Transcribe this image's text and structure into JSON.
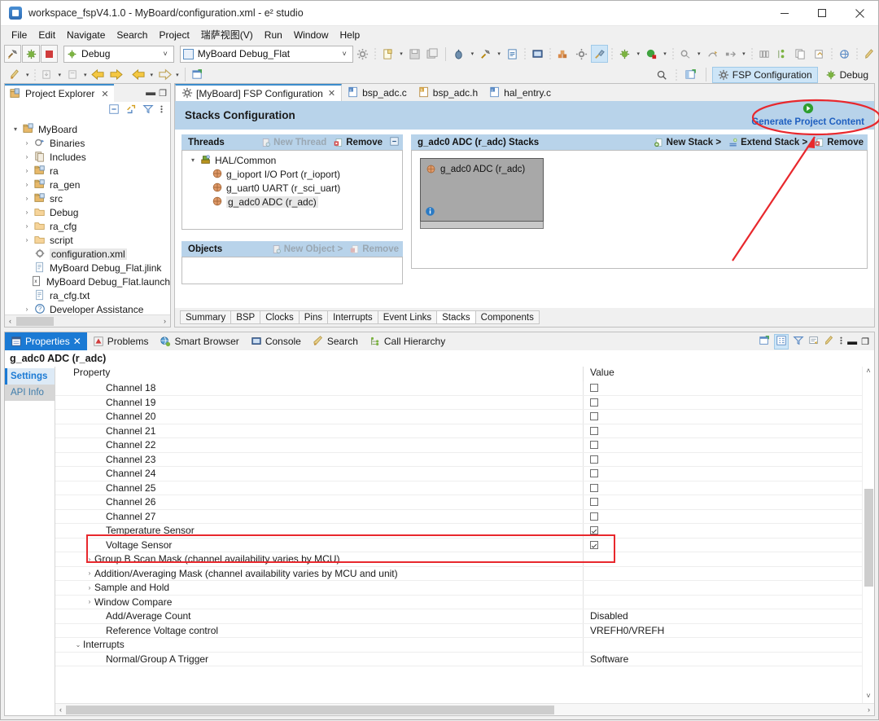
{
  "window": {
    "title": "workspace_fspV4.1.0 - MyBoard/configuration.xml - e² studio",
    "minimize": "—",
    "maximize": "□",
    "close": "✕",
    "app_icon": "e2-studio-icon"
  },
  "menu": [
    "File",
    "Edit",
    "Navigate",
    "Search",
    "Project",
    "瑞萨视图(V)",
    "Run",
    "Window",
    "Help"
  ],
  "toolbar": {
    "build_icon": "hammer-icon",
    "debug_icon": "debug-bug-icon",
    "stop_icon": "stop-icon",
    "launch_mode": "Debug",
    "launch_config": "MyBoard Debug_Flat",
    "icons": [
      "new-file-icon",
      "save-icon",
      "save-all-icon",
      "debug-icon",
      "build-hammer-icon",
      "report-icon",
      "terminal-icon",
      "blocks-icon",
      "gear-icon",
      "pin-tools-icon",
      "run-bug-icon",
      "run-green-icon",
      "skip-icon",
      "step-icon",
      "step-over-icon",
      "columns-icon",
      "outline-icon",
      "copy-icon",
      "export-icon",
      "globe-icon",
      "pencil-icon"
    ],
    "row2_icons": [
      "pencil-edit-icon",
      "download-icon",
      "sync-icon",
      "back-yellow-icon",
      "forward-yellow-icon",
      "back-arrow-icon",
      "forward-arrow-icon",
      "new-window-icon"
    ]
  },
  "perspectives": {
    "search_icon": "search-icon",
    "open_perspective_icon": "open-perspective-icon",
    "items": [
      {
        "label": "FSP Configuration",
        "icon": "gear-icon",
        "active": true
      },
      {
        "label": "Debug",
        "icon": "debug-bug-icon",
        "active": false
      }
    ]
  },
  "project_explorer": {
    "tab_label": "Project Explorer",
    "tab_icon": "project-explorer-icon",
    "close_icon": "✕",
    "minimize_icon": "—",
    "maximize_icon": "□",
    "toolbar_icons": [
      "collapse-all-icon",
      "link-editor-icon",
      "filter-icon",
      "view-menu-icon"
    ],
    "tree": [
      {
        "label": "MyBoard",
        "depth": 0,
        "arrow": "▾",
        "icon": "project-folder-icon",
        "selected": false
      },
      {
        "label": "Binaries",
        "depth": 1,
        "arrow": "›",
        "icon": "binaries-icon",
        "selected": false
      },
      {
        "label": "Includes",
        "depth": 1,
        "arrow": "›",
        "icon": "includes-icon",
        "selected": false
      },
      {
        "label": "ra",
        "depth": 1,
        "arrow": "›",
        "icon": "source-folder-icon",
        "selected": false
      },
      {
        "label": "ra_gen",
        "depth": 1,
        "arrow": "›",
        "icon": "source-folder-icon",
        "selected": false
      },
      {
        "label": "src",
        "depth": 1,
        "arrow": "›",
        "icon": "source-folder-icon",
        "selected": false
      },
      {
        "label": "Debug",
        "depth": 1,
        "arrow": "›",
        "icon": "folder-icon",
        "selected": false
      },
      {
        "label": "ra_cfg",
        "depth": 1,
        "arrow": "›",
        "icon": "folder-icon",
        "selected": false
      },
      {
        "label": "script",
        "depth": 1,
        "arrow": "›",
        "icon": "folder-icon",
        "selected": false
      },
      {
        "label": "configuration.xml",
        "depth": 1,
        "arrow": "",
        "icon": "config-xml-icon",
        "selected": true
      },
      {
        "label": "MyBoard Debug_Flat.jlink",
        "depth": 1,
        "arrow": "",
        "icon": "file-icon",
        "selected": false
      },
      {
        "label": "MyBoard Debug_Flat.launch",
        "depth": 1,
        "arrow": "",
        "icon": "launch-file-icon",
        "selected": false
      },
      {
        "label": "ra_cfg.txt",
        "depth": 1,
        "arrow": "",
        "icon": "file-icon",
        "selected": false
      },
      {
        "label": "Developer Assistance",
        "depth": 1,
        "arrow": "›",
        "icon": "help-icon",
        "selected": false
      }
    ]
  },
  "editor": {
    "tabs": [
      {
        "label": "[MyBoard] FSP Configuration",
        "icon": "gear-icon",
        "active": true,
        "close": "✕"
      },
      {
        "label": "bsp_adc.c",
        "icon": "c-file-icon",
        "active": false
      },
      {
        "label": "bsp_adc.h",
        "icon": "h-file-icon",
        "active": false
      },
      {
        "label": "hal_entry.c",
        "icon": "c-file-icon",
        "active": false
      }
    ],
    "banner_title": "Stacks Configuration",
    "generate_link": "Generate Project Content",
    "generate_icon": "play-green-icon",
    "threads": {
      "title": "Threads",
      "actions": [
        {
          "label": "New Thread",
          "icon": "new-thread-icon",
          "disabled": true
        },
        {
          "label": "Remove",
          "icon": "remove-icon",
          "disabled": false
        }
      ],
      "collapse_icon": "collapse-icon",
      "items": [
        {
          "label": "HAL/Common",
          "depth": 0,
          "arrow": "▾",
          "icon": "hal-icon",
          "selected": false
        },
        {
          "label": "g_ioport I/O Port (r_ioport)",
          "depth": 1,
          "arrow": "",
          "icon": "module-icon",
          "selected": false
        },
        {
          "label": "g_uart0 UART (r_sci_uart)",
          "depth": 1,
          "arrow": "",
          "icon": "module-icon",
          "selected": false
        },
        {
          "label": "g_adc0 ADC (r_adc)",
          "depth": 1,
          "arrow": "",
          "icon": "module-icon",
          "selected": true
        }
      ]
    },
    "objects": {
      "title": "Objects",
      "actions": [
        {
          "label": "New Object >",
          "icon": "new-object-icon",
          "disabled": true
        },
        {
          "label": "Remove",
          "icon": "remove-icon",
          "disabled": true
        }
      ]
    },
    "stacks": {
      "title": "g_adc0 ADC (r_adc) Stacks",
      "actions": [
        {
          "label": "New Stack >",
          "icon": "new-stack-icon",
          "disabled": false
        },
        {
          "label": "Extend Stack >",
          "icon": "extend-stack-icon",
          "disabled": false
        },
        {
          "label": "Remove",
          "icon": "remove-icon",
          "disabled": false
        }
      ],
      "block": {
        "label": "g_adc0 ADC (r_adc)",
        "icon": "module-icon",
        "info_icon": "info-icon"
      }
    },
    "bottom_tabs": [
      {
        "label": "Summary",
        "active": false
      },
      {
        "label": "BSP",
        "active": false
      },
      {
        "label": "Clocks",
        "active": false
      },
      {
        "label": "Pins",
        "active": false
      },
      {
        "label": "Interrupts",
        "active": false
      },
      {
        "label": "Event Links",
        "active": false
      },
      {
        "label": "Stacks",
        "active": true
      },
      {
        "label": "Components",
        "active": false
      }
    ]
  },
  "properties_view": {
    "tabs": [
      {
        "label": "Properties",
        "icon": "properties-icon",
        "active": true,
        "close": "✕"
      },
      {
        "label": "Problems",
        "icon": "problems-icon",
        "active": false
      },
      {
        "label": "Smart Browser",
        "icon": "smart-browser-icon",
        "active": false
      },
      {
        "label": "Console",
        "icon": "console-icon",
        "active": false
      },
      {
        "label": "Search",
        "icon": "search-rocket-icon",
        "active": false
      },
      {
        "label": "Call Hierarchy",
        "icon": "call-hierarchy-icon",
        "active": false
      }
    ],
    "view_tools": [
      "new-view-icon",
      "tree-mode-icon",
      "filter-icon",
      "restore-icon",
      "pin-icon",
      "view-menu-icon",
      "minimize-icon",
      "maximize-icon"
    ],
    "title": "g_adc0 ADC (r_adc)",
    "side_tabs": [
      {
        "label": "Settings",
        "selected": true
      },
      {
        "label": "API Info",
        "selected": false
      }
    ],
    "columns": [
      "Property",
      "Value"
    ],
    "rows": [
      {
        "label": "Channel 18",
        "indent": 3,
        "expander": "",
        "value": "",
        "checkbox": "off",
        "highlight": false
      },
      {
        "label": "Channel 19",
        "indent": 3,
        "expander": "",
        "value": "",
        "checkbox": "off",
        "highlight": false
      },
      {
        "label": "Channel 20",
        "indent": 3,
        "expander": "",
        "value": "",
        "checkbox": "off",
        "highlight": false
      },
      {
        "label": "Channel 21",
        "indent": 3,
        "expander": "",
        "value": "",
        "checkbox": "off",
        "highlight": false
      },
      {
        "label": "Channel 22",
        "indent": 3,
        "expander": "",
        "value": "",
        "checkbox": "off",
        "highlight": false
      },
      {
        "label": "Channel 23",
        "indent": 3,
        "expander": "",
        "value": "",
        "checkbox": "off",
        "highlight": false
      },
      {
        "label": "Channel 24",
        "indent": 3,
        "expander": "",
        "value": "",
        "checkbox": "off",
        "highlight": false
      },
      {
        "label": "Channel 25",
        "indent": 3,
        "expander": "",
        "value": "",
        "checkbox": "off",
        "highlight": false
      },
      {
        "label": "Channel 26",
        "indent": 3,
        "expander": "",
        "value": "",
        "checkbox": "off",
        "highlight": false
      },
      {
        "label": "Channel 27",
        "indent": 3,
        "expander": "",
        "value": "",
        "checkbox": "off",
        "highlight": false
      },
      {
        "label": "Temperature Sensor",
        "indent": 3,
        "expander": "",
        "value": "",
        "checkbox": "on",
        "highlight": true
      },
      {
        "label": "Voltage Sensor",
        "indent": 3,
        "expander": "",
        "value": "",
        "checkbox": "on",
        "highlight": true
      },
      {
        "label": "Group B Scan Mask (channel availability varies by MCU)",
        "indent": 2,
        "expander": "›",
        "value": "",
        "checkbox": "",
        "highlight": false
      },
      {
        "label": "Addition/Averaging Mask (channel availability varies by MCU and unit)",
        "indent": 2,
        "expander": "›",
        "value": "",
        "checkbox": "",
        "highlight": false
      },
      {
        "label": "Sample and Hold",
        "indent": 2,
        "expander": "›",
        "value": "",
        "checkbox": "",
        "highlight": false
      },
      {
        "label": "Window Compare",
        "indent": 2,
        "expander": "›",
        "value": "",
        "checkbox": "",
        "highlight": false
      },
      {
        "label": "Add/Average Count",
        "indent": 3,
        "expander": "",
        "value": "Disabled",
        "checkbox": "",
        "highlight": false
      },
      {
        "label": "Reference Voltage control",
        "indent": 3,
        "expander": "",
        "value": "VREFH0/VREFH",
        "checkbox": "",
        "highlight": false
      },
      {
        "label": "Interrupts",
        "indent": 1,
        "expander": "⌄",
        "value": "",
        "checkbox": "",
        "highlight": false
      },
      {
        "label": "Normal/Group A Trigger",
        "indent": 3,
        "expander": "",
        "value": "Software",
        "checkbox": "",
        "highlight": false
      }
    ]
  },
  "annotations": {
    "ellipse_target": "Generate Project Content",
    "arrow_color": "#e8282d",
    "highlight_box_color": "#e8282d"
  }
}
